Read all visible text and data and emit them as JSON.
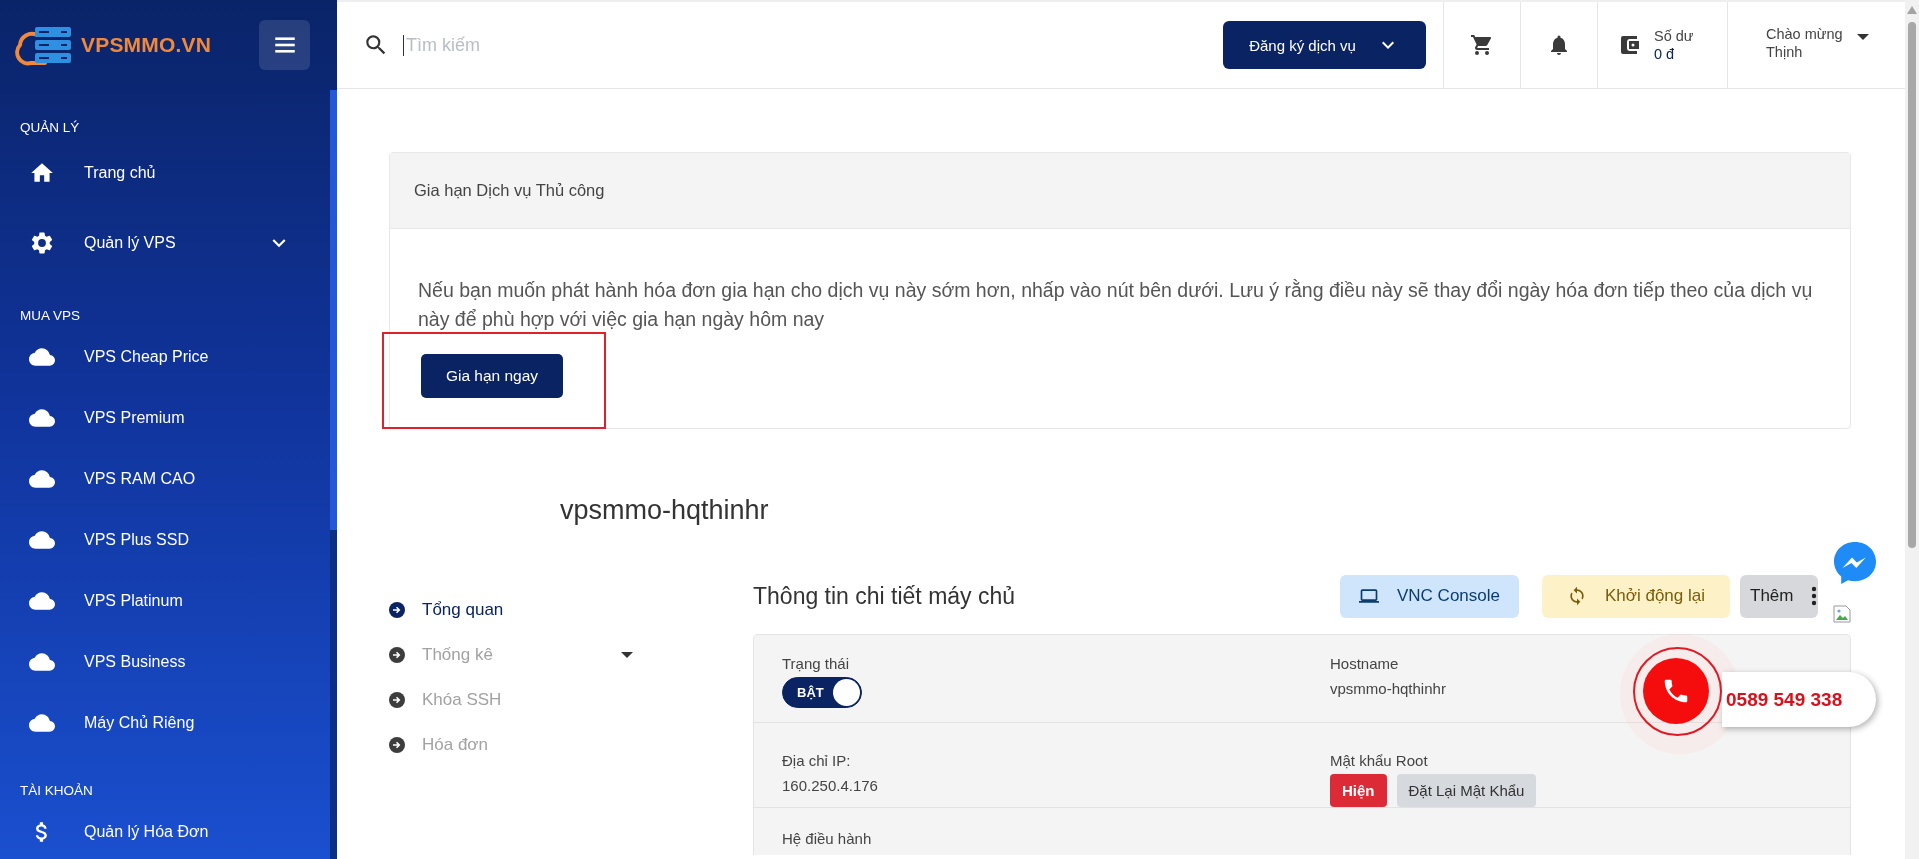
{
  "sidebar": {
    "logo": "VPSMMO.VN",
    "sections": [
      {
        "heading": "QUẢN LÝ",
        "items": [
          {
            "label": "Trang chủ",
            "kind": "home",
            "has_submenu": false
          },
          {
            "label": "Quản lý VPS",
            "kind": "settings",
            "has_submenu": true
          }
        ]
      },
      {
        "heading": "MUA VPS",
        "items": [
          {
            "label": "VPS Cheap Price",
            "kind": "product",
            "has_submenu": false
          },
          {
            "label": "VPS Premium",
            "kind": "product",
            "has_submenu": false
          },
          {
            "label": "VPS RAM CAO",
            "kind": "product",
            "has_submenu": false
          },
          {
            "label": "VPS Plus SSD",
            "kind": "product",
            "has_submenu": false
          },
          {
            "label": "VPS Platinum",
            "kind": "product",
            "has_submenu": false
          },
          {
            "label": "VPS Business",
            "kind": "product",
            "has_submenu": false
          },
          {
            "label": "Máy Chủ Riêng",
            "kind": "product",
            "has_submenu": false
          }
        ]
      },
      {
        "heading": "TÀI KHOẢN",
        "items": [
          {
            "label": "Quản lý Hóa Đơn",
            "kind": "billing",
            "has_submenu": false
          }
        ]
      }
    ]
  },
  "topbar": {
    "search": {
      "placeholder": "Tìm kiếm"
    },
    "register_button": "Đăng ký dịch vụ",
    "balance_label": "Số dư",
    "balance_value": "0 đ",
    "greeting": "Chào mừng",
    "user": "Thịnh"
  },
  "renew_card": {
    "title": "Gia hạn Dịch vụ Thủ công",
    "text": "Nếu bạn muốn phát hành hóa đơn gia hạn cho dịch vụ này sớm hơn, nhấp vào nút bên dưới. Lưu ý rằng điều này sẽ thay đổi ngày hóa đơn tiếp theo của dịch vụ này để phù hợp với việc gia hạn ngày hôm nay",
    "button": "Gia hạn ngay",
    "highlighted": true
  },
  "server": {
    "name": "vpsmmo-hqthinhr",
    "tabs": [
      {
        "label": "Tổng quan",
        "selected": true,
        "has_dropdown": false
      },
      {
        "label": "Thống kê",
        "selected": false,
        "has_dropdown": true
      },
      {
        "label": "Khóa SSH",
        "selected": false,
        "has_dropdown": false
      },
      {
        "label": "Hóa đơn",
        "selected": false,
        "has_dropdown": false
      }
    ],
    "section_title": "Thông tin chi tiết máy chủ",
    "actions": [
      {
        "label": "VNC Console",
        "kind": "vnc"
      },
      {
        "label": "Khởi động lại",
        "kind": "restart"
      },
      {
        "label": "Thêm",
        "kind": "more"
      }
    ],
    "fields": [
      {
        "label": "Trạng thái",
        "kind": "toggle",
        "toggle_label": "BẬT",
        "on": true
      },
      {
        "label": "Hostname",
        "kind": "text",
        "value": "vpsmmo-hqthinhr"
      },
      {
        "label": "Địa chỉ IP:",
        "kind": "text",
        "value": "160.250.4.176"
      },
      {
        "label": "Mật khẩu Root",
        "kind": "buttons",
        "buttons": [
          {
            "label": "Hiện",
            "kind": "danger"
          },
          {
            "label": "Đặt Lại Mật Khẩu",
            "kind": "secondary"
          }
        ]
      },
      {
        "label": "Hệ điều hành",
        "kind": "text"
      }
    ]
  },
  "call_widget": {
    "phone": "0589 549 338"
  }
}
